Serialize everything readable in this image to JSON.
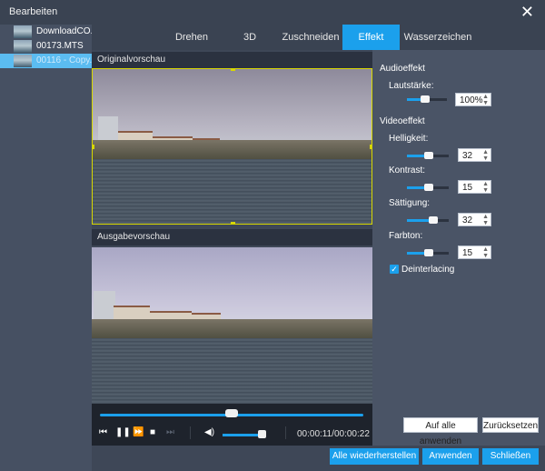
{
  "window": {
    "title": "Bearbeiten",
    "close_label": "✕"
  },
  "files": [
    {
      "name": "DownloadCO..."
    },
    {
      "name": "00173.MTS"
    },
    {
      "name": "00116 - Copy..."
    }
  ],
  "tabs": [
    {
      "label": "Drehen"
    },
    {
      "label": "3D"
    },
    {
      "label": "Zuschneiden"
    },
    {
      "label": "Effekt"
    },
    {
      "label": "Wasserzeichen"
    }
  ],
  "active_tab": "Effekt",
  "preview": {
    "original_label": "Originalvorschau",
    "output_label": "Ausgabevorschau"
  },
  "player": {
    "time": "00:00:11/00:00:22",
    "progress": 0.5,
    "volume_level": 1.0,
    "icons": [
      "skip-back-icon",
      "pause-icon",
      "fast-forward-icon",
      "stop-icon",
      "skip-forward-icon",
      "volume-icon"
    ]
  },
  "audio": {
    "section_label": "Audioeffekt",
    "volume_label": "Lautstärke:",
    "volume_value": "100%"
  },
  "video_effects": {
    "section_label": "Videoeffekt",
    "brightness_label": "Helligkeit:",
    "brightness_value": "32",
    "contrast_label": "Kontrast:",
    "contrast_value": "15",
    "saturation_label": "Sättigung:",
    "saturation_value": "32",
    "hue_label": "Farbton:",
    "hue_value": "15",
    "deinterlace_label": "Deinterlacing",
    "deinterlace_checked": true
  },
  "buttons": {
    "apply_all": "Auf alle anwenden",
    "reset": "Zurücksetzen",
    "restore_all": "Alle wiederherstellen",
    "apply": "Anwenden",
    "close": "Schließen"
  },
  "colors": {
    "accent": "#1ba0ec",
    "background": "#3e4757",
    "crop_border": "#d7d700"
  }
}
